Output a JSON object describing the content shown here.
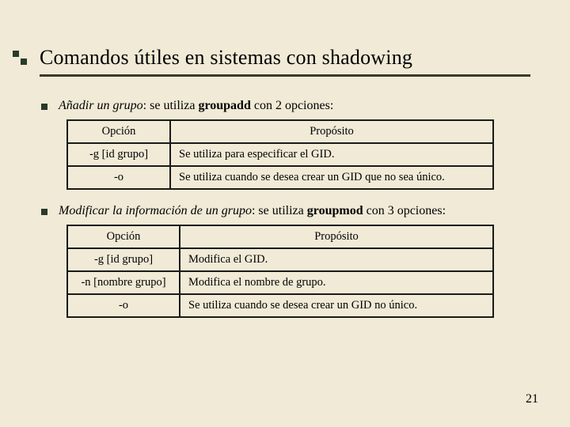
{
  "title": "Comandos útiles en sistemas con shadowing",
  "section1": {
    "lead_italic": "Añadir un grupo",
    "lead_rest": ": se utiliza ",
    "lead_cmd": "groupadd",
    "lead_tail": " con 2 opciones:",
    "headers": {
      "opt": "Opción",
      "purpose": "Propósito"
    },
    "rows": [
      {
        "opt": "-g [id grupo]",
        "purpose": "Se utiliza para especificar el GID."
      },
      {
        "opt": "-o",
        "purpose": "Se utiliza cuando se desea crear un GID que no sea único."
      }
    ]
  },
  "section2": {
    "lead_italic": "Modificar la información de un grupo",
    "lead_rest": ": se utiliza ",
    "lead_cmd": "groupmod",
    "lead_tail": " con 3 opciones:",
    "headers": {
      "opt": "Opción",
      "purpose": "Propósito"
    },
    "rows": [
      {
        "opt": "-g [id grupo]",
        "purpose": "Modifica el GID."
      },
      {
        "opt": "-n [nombre grupo]",
        "purpose": "Modifica el nombre de grupo."
      },
      {
        "opt": "-o",
        "purpose": "Se utiliza cuando se desea crear un GID no único."
      }
    ]
  },
  "page_number": "21",
  "chart_data": {
    "type": "table",
    "tables": [
      {
        "title": "groupadd options",
        "columns": [
          "Opción",
          "Propósito"
        ],
        "rows": [
          [
            "-g [id grupo]",
            "Se utiliza para especificar el GID."
          ],
          [
            "-o",
            "Se utiliza cuando se desea crear un GID que no sea único."
          ]
        ]
      },
      {
        "title": "groupmod options",
        "columns": [
          "Opción",
          "Propósito"
        ],
        "rows": [
          [
            "-g [id grupo]",
            "Modifica el GID."
          ],
          [
            "-n [nombre grupo]",
            "Modifica el nombre de grupo."
          ],
          [
            "-o",
            "Se utiliza cuando se desea crear un GID no único."
          ]
        ]
      }
    ]
  }
}
